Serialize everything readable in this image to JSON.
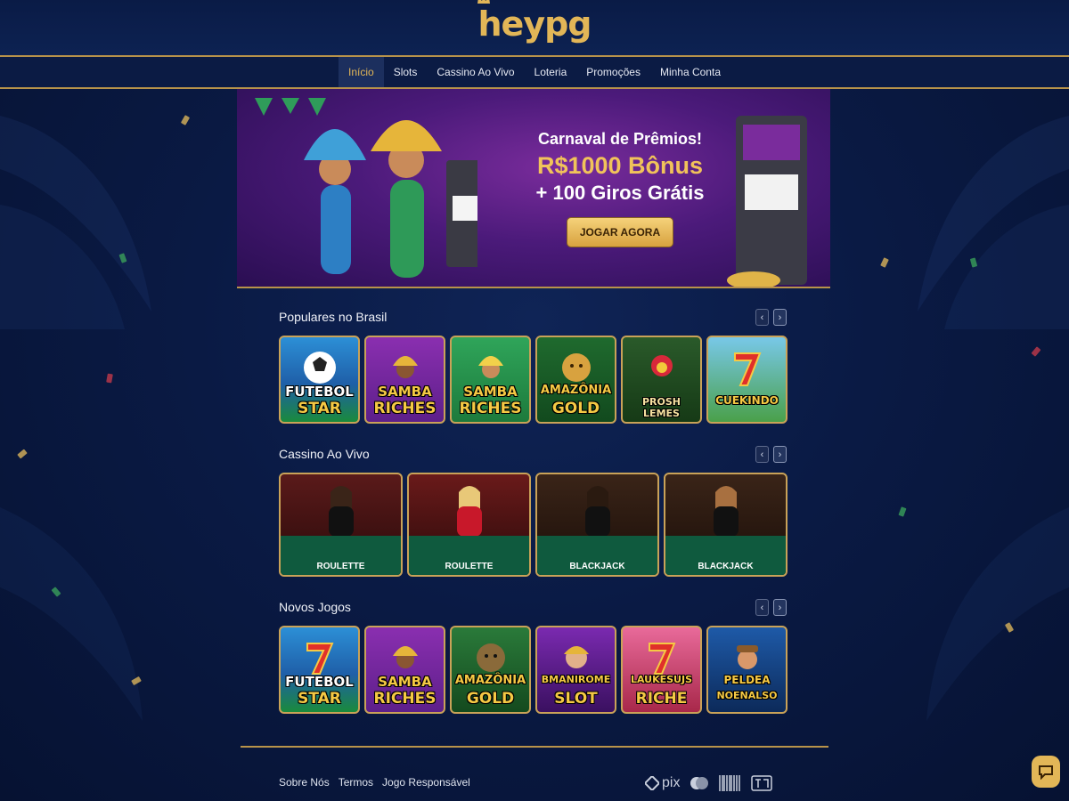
{
  "brand": {
    "logo_text": "heypg",
    "accent_color": "#e2b657"
  },
  "nav": {
    "items": [
      {
        "label": "Início",
        "active": true
      },
      {
        "label": "Slots"
      },
      {
        "label": "Cassino Ao Vivo"
      },
      {
        "label": "Loteria"
      },
      {
        "label": "Promoções"
      },
      {
        "label": "Minha Conta"
      }
    ]
  },
  "banner": {
    "line1": "Carnaval de Prêmios!",
    "line2": "R$1000 Bônus",
    "line3": "+ 100 Giros Grátis",
    "cta": "JOGAR AGORA"
  },
  "sections": {
    "popular": {
      "title": "Populares no Brasil",
      "games": [
        {
          "l1": "FUTEBOL",
          "l2": "STAR"
        },
        {
          "l1": "SAMBA",
          "l2": "RICHES"
        },
        {
          "l1": "SAMBA",
          "l2": "RICHES"
        },
        {
          "l1": "AMAZÔNIA",
          "l2": "GOLD"
        },
        {
          "l1": "",
          "l2": "PROSH LEMES"
        },
        {
          "l1": "",
          "l2": "CUEKINDO"
        }
      ]
    },
    "live": {
      "title": "Cassino Ao Vivo",
      "tables": [
        {
          "label": "ROULETTE"
        },
        {
          "label": "ROULETTE"
        },
        {
          "label": "BLACKJACK"
        },
        {
          "label": "BLACKJACK"
        }
      ]
    },
    "new": {
      "title": "Novos Jogos",
      "games": [
        {
          "l1": "FUTEBOL",
          "l2": "STAR"
        },
        {
          "l1": "SAMBA",
          "l2": "RICHES"
        },
        {
          "l1": "AMAZÔNIA",
          "l2": "GOLD"
        },
        {
          "l1": "BMANIROME",
          "l2": "SLOT"
        },
        {
          "l1": "LAUKESUJS",
          "l2": "RICHE"
        },
        {
          "l1": "PELDEA",
          "l2": "NOENALSO"
        }
      ]
    }
  },
  "footer": {
    "links": [
      "Sobre Nós",
      "Termos",
      "Jogo Responsável"
    ],
    "payments": [
      "pix",
      "mastercard",
      "boleto",
      "ted"
    ]
  }
}
